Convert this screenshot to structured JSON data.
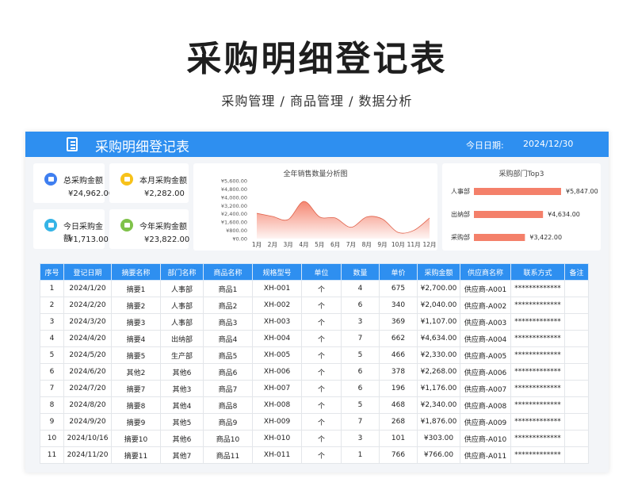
{
  "hero": {
    "title": "采购明细登记表",
    "subtitle": "采购管理 / 商品管理 / 数据分析"
  },
  "topbar": {
    "title": "采购明细登记表",
    "date_label": "今日日期:",
    "date_value": "2024/12/30"
  },
  "kpis": [
    {
      "label": "总采购金额",
      "value": "¥24,962.00",
      "color": "#3f7ff0"
    },
    {
      "label": "本月采购金额",
      "value": "¥2,282.00",
      "color": "#f7c21a"
    },
    {
      "label": "今日采购金额",
      "value": "¥1,713.00",
      "color": "#35b4e6"
    },
    {
      "label": "今年采购金额",
      "value": "¥23,822.00",
      "color": "#7fc24a"
    }
  ],
  "colors": {
    "accent": "#2e8ff0",
    "chart": "#f4806a"
  },
  "chart_data": [
    {
      "type": "area",
      "title": "全年销售数量分析图",
      "categories": [
        "1月",
        "2月",
        "3月",
        "4月",
        "5月",
        "6月",
        "7月",
        "8月",
        "9月",
        "10月",
        "11月",
        "12月"
      ],
      "values": [
        2450,
        2150,
        1850,
        3600,
        2100,
        2000,
        1100,
        2100,
        1900,
        600,
        800,
        2000
      ],
      "ylim": [
        0,
        5600
      ],
      "yticks": [
        "¥5,600.00",
        "¥4,800.00",
        "¥4,000.00",
        "¥3,200.00",
        "¥2,400.00",
        "¥1,600.00",
        "¥800.00",
        "¥0.00"
      ],
      "tick_values": [
        5600,
        4800,
        4000,
        3200,
        2400,
        1600,
        800,
        0
      ]
    },
    {
      "type": "bar",
      "title": "采购部门Top3",
      "categories": [
        "人事部",
        "出纳部",
        "采购部"
      ],
      "values": [
        5847,
        4634,
        3422
      ],
      "labels": [
        "¥5,847.00",
        "¥4,634.00",
        "¥3,422.00"
      ]
    }
  ],
  "table": {
    "headers": [
      "序号",
      "登记日期",
      "摘要名称",
      "部门名称",
      "商品名称",
      "规格型号",
      "单位",
      "数量",
      "单价",
      "采购金额",
      "供应商名称",
      "联系方式",
      "备注"
    ],
    "rows": [
      [
        "1",
        "2024/1/20",
        "摘要1",
        "人事部",
        "商品1",
        "XH-001",
        "个",
        "4",
        "675",
        "¥2,700.00",
        "供应商-A001",
        "*************",
        ""
      ],
      [
        "2",
        "2024/2/20",
        "摘要2",
        "人事部",
        "商品2",
        "XH-002",
        "个",
        "6",
        "340",
        "¥2,040.00",
        "供应商-A002",
        "*************",
        ""
      ],
      [
        "3",
        "2024/3/20",
        "摘要3",
        "人事部",
        "商品3",
        "XH-003",
        "个",
        "3",
        "369",
        "¥1,107.00",
        "供应商-A003",
        "*************",
        ""
      ],
      [
        "4",
        "2024/4/20",
        "摘要4",
        "出纳部",
        "商品4",
        "XH-004",
        "个",
        "7",
        "662",
        "¥4,634.00",
        "供应商-A004",
        "*************",
        ""
      ],
      [
        "5",
        "2024/5/20",
        "摘要5",
        "生产部",
        "商品5",
        "XH-005",
        "个",
        "5",
        "466",
        "¥2,330.00",
        "供应商-A005",
        "*************",
        ""
      ],
      [
        "6",
        "2024/6/20",
        "其他2",
        "其他6",
        "商品6",
        "XH-006",
        "个",
        "6",
        "378",
        "¥2,268.00",
        "供应商-A006",
        "*************",
        ""
      ],
      [
        "7",
        "2024/7/20",
        "摘要7",
        "其他3",
        "商品7",
        "XH-007",
        "个",
        "6",
        "196",
        "¥1,176.00",
        "供应商-A007",
        "*************",
        ""
      ],
      [
        "8",
        "2024/8/20",
        "摘要8",
        "其他4",
        "商品8",
        "XH-008",
        "个",
        "5",
        "468",
        "¥2,340.00",
        "供应商-A008",
        "*************",
        ""
      ],
      [
        "9",
        "2024/9/20",
        "摘要9",
        "其他5",
        "商品9",
        "XH-009",
        "个",
        "7",
        "268",
        "¥1,876.00",
        "供应商-A009",
        "*************",
        ""
      ],
      [
        "10",
        "2024/10/16",
        "摘要10",
        "其他6",
        "商品10",
        "XH-010",
        "个",
        "3",
        "101",
        "¥303.00",
        "供应商-A010",
        "*************",
        ""
      ],
      [
        "11",
        "2024/11/20",
        "摘要11",
        "其他7",
        "商品11",
        "XH-011",
        "个",
        "1",
        "766",
        "¥766.00",
        "供应商-A011",
        "*************",
        ""
      ]
    ]
  }
}
